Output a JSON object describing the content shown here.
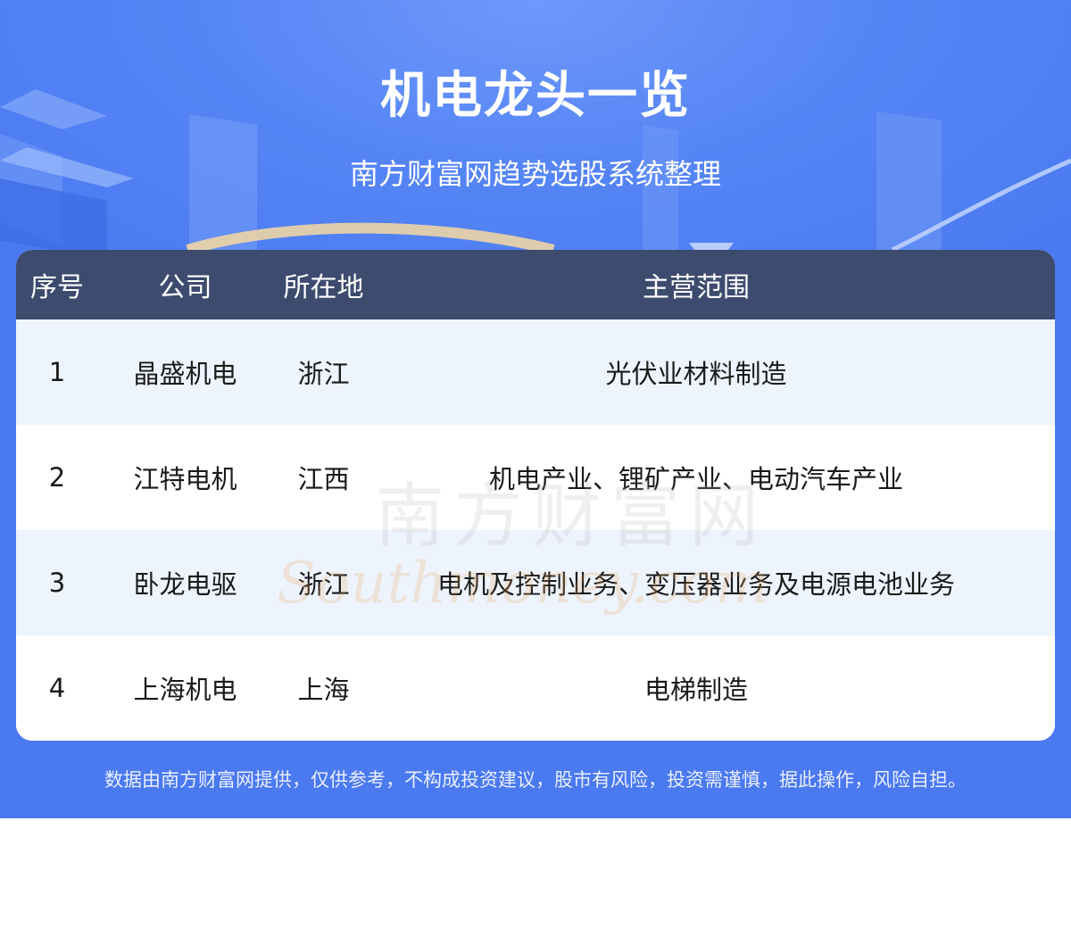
{
  "header": {
    "title": "机电龙头一览",
    "subtitle": "南方财富网趋势选股系统整理"
  },
  "table": {
    "columns": [
      "序号",
      "公司",
      "所在地",
      "主营范围"
    ],
    "rows": [
      {
        "index": "1",
        "company": "晶盛机电",
        "location": "浙江",
        "business": "光伏业材料制造"
      },
      {
        "index": "2",
        "company": "江特电机",
        "location": "江西",
        "business": "机电产业、锂矿产业、电动汽车产业"
      },
      {
        "index": "3",
        "company": "卧龙电驱",
        "location": "浙江",
        "business": "电机及控制业务、变压器业务及电源电池业务"
      },
      {
        "index": "4",
        "company": "上海机电",
        "location": "上海",
        "business": "电梯制造"
      }
    ]
  },
  "footer": {
    "disclaimer": "数据由南方财富网提供，仅供参考，不构成投资建议，股市有风险，投资需谨慎，据此操作，风险自担。"
  },
  "watermark": {
    "text_cn": "南方财富网",
    "text_en": "Southmoney.com"
  },
  "colors": {
    "background": "#4a79f0",
    "table_header": "#3d4b6e",
    "row_alt": "#eef4fe",
    "row": "#ffffff"
  }
}
